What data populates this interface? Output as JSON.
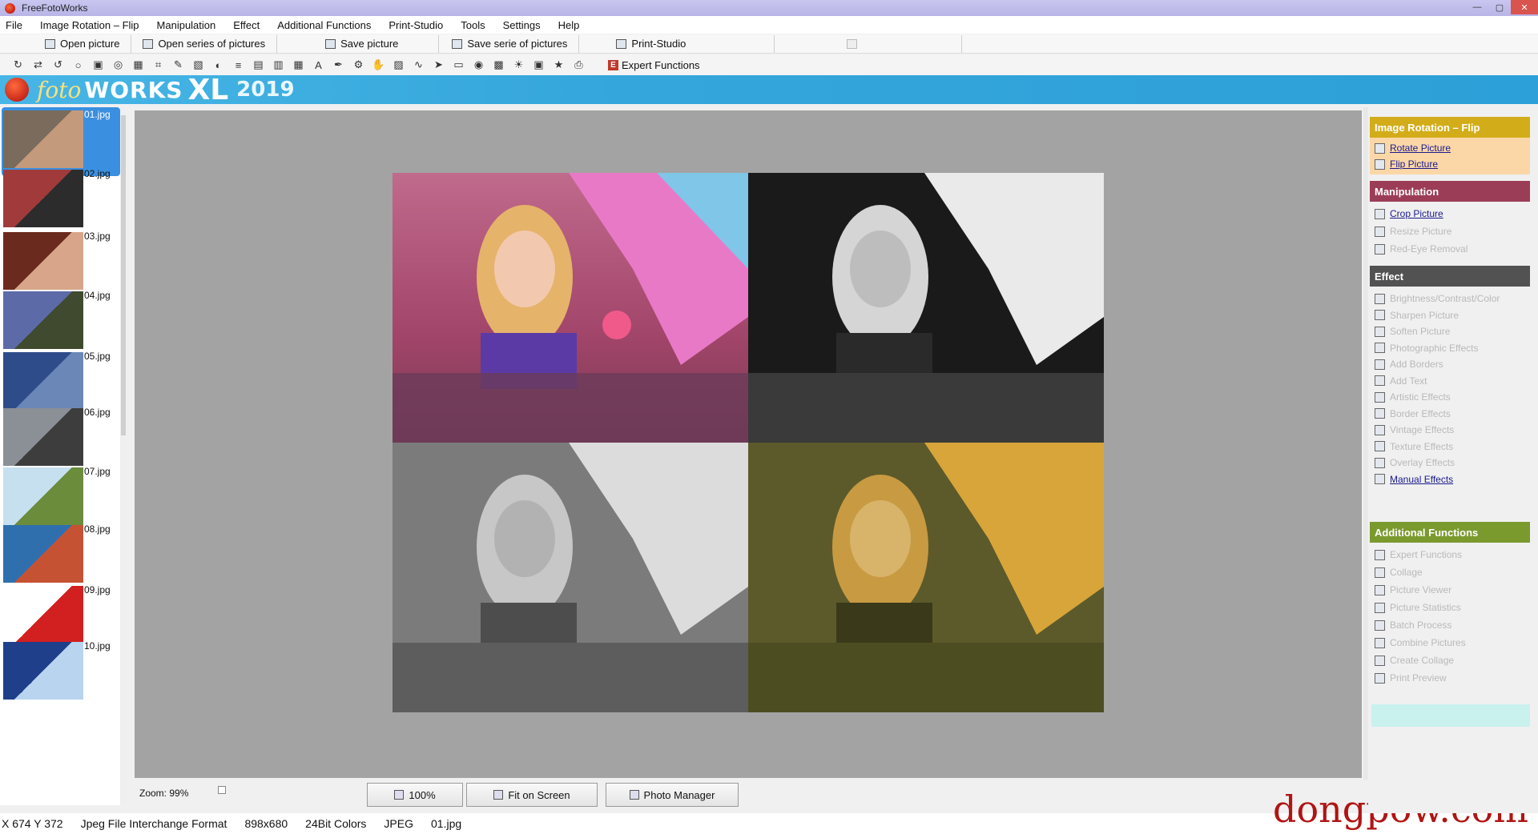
{
  "window": {
    "title": "FreeFotoWorks"
  },
  "menu": [
    "File",
    "Image Rotation – Flip",
    "Manipulation",
    "Effect",
    "Additional Functions",
    "Print-Studio",
    "Tools",
    "Settings",
    "Help"
  ],
  "toolbar1": [
    {
      "label": "Open picture"
    },
    {
      "label": "Open series of pictures"
    },
    {
      "label": "Save picture"
    },
    {
      "label": "Save serie of pictures"
    },
    {
      "label": "Print-Studio"
    }
  ],
  "toolbar2": {
    "icons": [
      "rotate-icon",
      "flip-icon",
      "refresh-icon",
      "circle-icon",
      "frame-icon",
      "spiral-icon",
      "grid-icon",
      "crop-icon",
      "brush-icon",
      "fill-icon",
      "adjust-icon",
      "levels-icon",
      "film-icon",
      "layers-icon",
      "table-icon",
      "text-icon",
      "pen-icon",
      "filter-icon",
      "hand-icon",
      "chart-icon",
      "wave-icon",
      "arrow-icon",
      "page-icon",
      "eye-icon",
      "mosaic-icon",
      "sun-icon",
      "collage-icon",
      "star-icon",
      "print-icon"
    ],
    "expert": "Expert Functions"
  },
  "banner": {
    "a": "foto",
    "b": "WORKS",
    "c": "XL",
    "d": "2019"
  },
  "thumbnails": [
    {
      "name": "01.jpg"
    },
    {
      "name": "02.jpg"
    },
    {
      "name": "03.jpg"
    },
    {
      "name": "04.jpg"
    },
    {
      "name": "05.jpg"
    },
    {
      "name": "06.jpg"
    },
    {
      "name": "07.jpg"
    },
    {
      "name": "08.jpg"
    },
    {
      "name": "09.jpg"
    },
    {
      "name": "10.jpg"
    }
  ],
  "bottom": {
    "zoom": "Zoom: 99%",
    "btn100": "100%",
    "fit": "Fit on Screen",
    "manager": "Photo Manager"
  },
  "status": {
    "coords": "X 674 Y 372",
    "format": "Jpeg File Interchange Format",
    "size": "898x680",
    "colors": "24Bit Colors",
    "type": "JPEG",
    "file": "01.jpg"
  },
  "watermark": "dongpow.com",
  "panel": {
    "rotation": {
      "title": "Image Rotation – Flip",
      "items": [
        "Rotate Picture",
        "Flip Picture"
      ]
    },
    "manipulation": {
      "title": "Manipulation",
      "items": [
        "Crop Picture",
        "Resize Picture",
        "Red-Eye Removal"
      ]
    },
    "effect": {
      "title": "Effect",
      "items": [
        "Brightness/Contrast/Color",
        "Sharpen Picture",
        "Soften Picture",
        "Photographic Effects",
        "Add Borders",
        "Add Text",
        "Artistic Effects",
        "Border Effects",
        "Vintage Effects",
        "Texture Effects",
        "Overlay Effects",
        "Manual Effects"
      ]
    },
    "additional": {
      "title": "Additional Functions",
      "items": [
        "Expert Functions",
        "Collage",
        "Picture Viewer",
        "Picture Statistics",
        "Batch Process",
        "Combine Pictures",
        "Create Collage",
        "Print Preview"
      ]
    }
  },
  "colors": {
    "rotation_head": "#d3ad19",
    "rotation_bg": "#fbd7a8",
    "manipulation_head": "#9c3d58",
    "effect_head": "#525252",
    "additional_head": "#7b9a2e",
    "banner": "#35a6db"
  }
}
